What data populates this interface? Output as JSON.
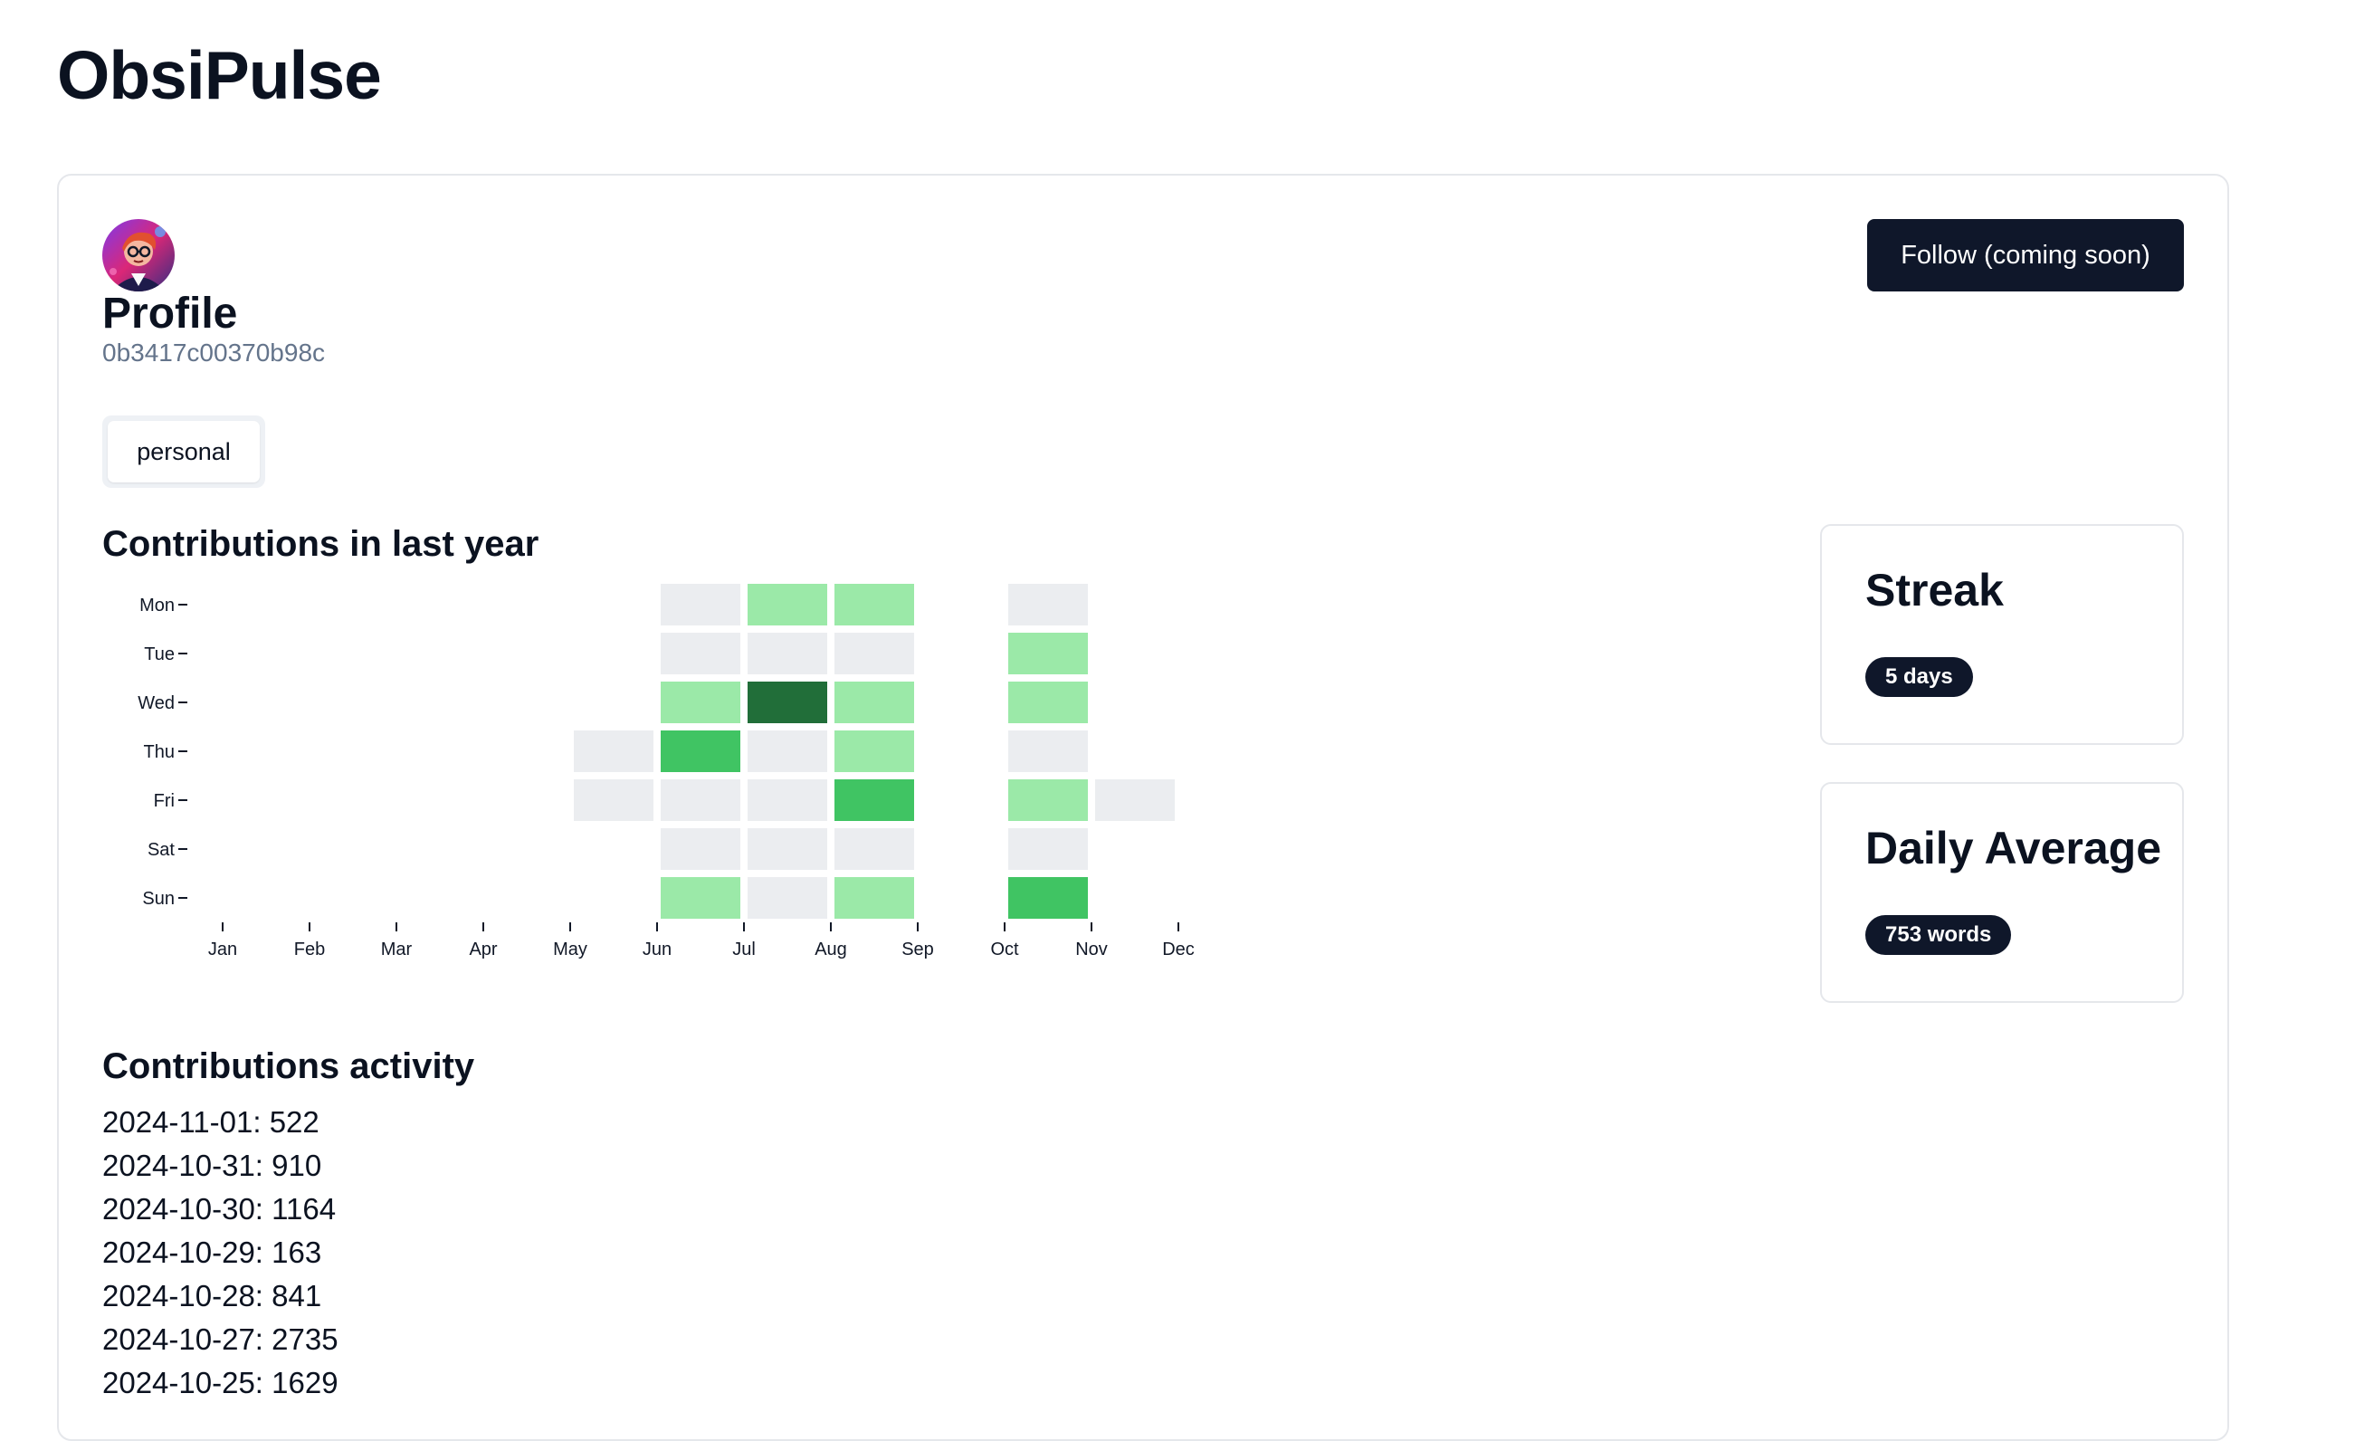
{
  "app": {
    "title": "ObsiPulse"
  },
  "profile": {
    "name": "Profile",
    "id": "0b3417c00370b98c",
    "tag": "personal",
    "follow_label": "Follow (coming soon)"
  },
  "contributions": {
    "title": "Contributions in last year",
    "activity_title": "Contributions activity",
    "activity": [
      {
        "text": "2024-11-01: 522"
      },
      {
        "text": "2024-10-31: 910"
      },
      {
        "text": "2024-10-30: 1164"
      },
      {
        "text": "2024-10-29: 163"
      },
      {
        "text": "2024-10-28: 841"
      },
      {
        "text": "2024-10-27: 2735"
      },
      {
        "text": "2024-10-25: 1629"
      }
    ]
  },
  "stats": {
    "streak": {
      "title": "Streak",
      "value": "5 days"
    },
    "daily_average": {
      "title": "Daily Average",
      "value": "753 words"
    }
  },
  "colors": {
    "empty": "#ebedf0",
    "level1": "#9be9a8",
    "level2": "#40c463",
    "level3": "#216e39",
    "accent": "#0f172a"
  },
  "chart_data": {
    "type": "heatmap",
    "title": "Contributions in last year",
    "rows": [
      "Mon",
      "Tue",
      "Wed",
      "Thu",
      "Fri",
      "Sat",
      "Sun"
    ],
    "columns": [
      "Jan",
      "Feb",
      "Mar",
      "Apr",
      "May",
      "Jun",
      "Jul",
      "Aug",
      "Sep",
      "Oct",
      "Nov",
      "Dec"
    ],
    "levels": [
      [
        null,
        null,
        null,
        null,
        null,
        0,
        1,
        1,
        null,
        0,
        null,
        null
      ],
      [
        null,
        null,
        null,
        null,
        null,
        0,
        0,
        0,
        null,
        1,
        null,
        null
      ],
      [
        null,
        null,
        null,
        null,
        null,
        1,
        3,
        1,
        null,
        1,
        null,
        null
      ],
      [
        null,
        null,
        null,
        null,
        0,
        2,
        0,
        1,
        null,
        0,
        null,
        null
      ],
      [
        null,
        null,
        null,
        null,
        0,
        0,
        0,
        2,
        null,
        1,
        0,
        null
      ],
      [
        null,
        null,
        null,
        null,
        null,
        0,
        0,
        0,
        null,
        0,
        null,
        null
      ],
      [
        null,
        null,
        null,
        null,
        null,
        1,
        0,
        1,
        null,
        2,
        null,
        null
      ]
    ]
  }
}
